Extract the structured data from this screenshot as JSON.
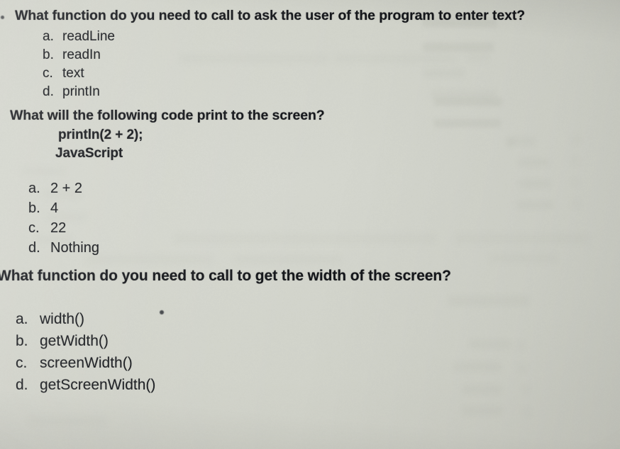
{
  "page": {
    "medium": "photograph-of-printed-quiz-page",
    "paper_color": "#cfd1c8",
    "ink_color": "#14161a"
  },
  "questions": [
    {
      "id": "q1",
      "marker": "bullet-marker",
      "prompt": "What function do you need to call to ask the user of the program to enter text?",
      "options": [
        {
          "letter": "a.",
          "text": "readLine"
        },
        {
          "letter": "b.",
          "text": "readIn"
        },
        {
          "letter": "c.",
          "text": "text"
        },
        {
          "letter": "d.",
          "text": "printIn"
        }
      ]
    },
    {
      "id": "q2",
      "prompt": "What will the following code print to the screen?",
      "code_lines": [
        "println(2 + 2);",
        "JavaScript"
      ],
      "options": [
        {
          "letter": "a.",
          "text": "2 + 2"
        },
        {
          "letter": "b.",
          "text": "4"
        },
        {
          "letter": "c.",
          "text": "22"
        },
        {
          "letter": "d.",
          "text": "Nothing"
        }
      ]
    },
    {
      "id": "q3",
      "prompt": "What function do you need to call to get the width of the screen?",
      "options": [
        {
          "letter": "a.",
          "text": "width()"
        },
        {
          "letter": "b.",
          "text": "getWidth()"
        },
        {
          "letter": "c.",
          "text": "screenWidth()"
        },
        {
          "letter": "d.",
          "text": "getScreenWidth()"
        }
      ]
    }
  ]
}
